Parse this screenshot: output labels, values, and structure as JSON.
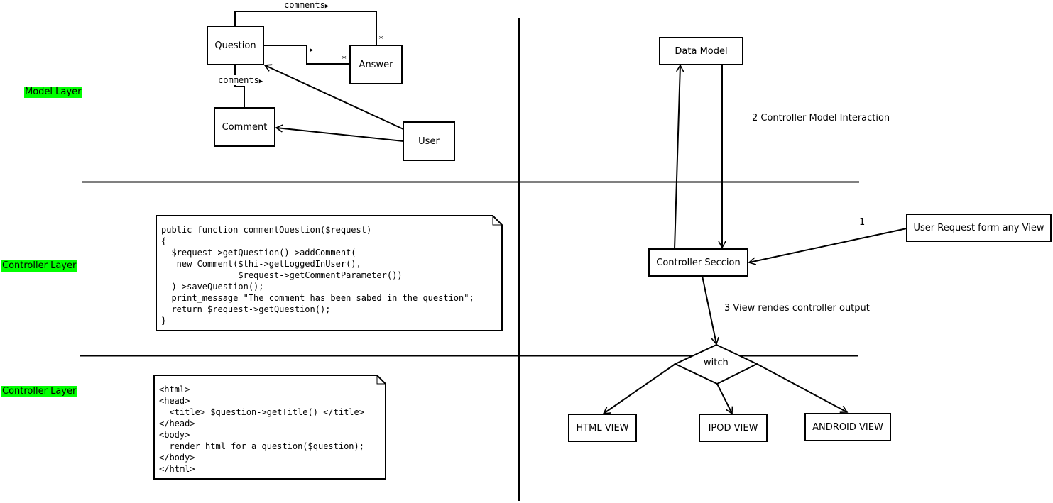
{
  "layers": {
    "model": {
      "label": "Model Layer",
      "highlight_color": "#00ff00"
    },
    "controller": {
      "label": "Controller Layer",
      "highlight_color": "#00ff00"
    },
    "view": {
      "label": "Controller Layer",
      "highlight_color": "#00ff00"
    }
  },
  "uml": {
    "classes": {
      "question": "Question",
      "answer": "Answer",
      "comment": "Comment",
      "user": "User"
    },
    "associations": {
      "question_answer_top": {
        "label": "comments",
        "direction_glyph": "▶",
        "multiplicity_answer": "*"
      },
      "question_answer_mid": {
        "direction_glyph": "▶",
        "multiplicity_answer": "*"
      },
      "question_comment": {
        "label": "comments",
        "direction_glyph": "▶"
      }
    }
  },
  "controller_code": {
    "lines": [
      "public function commentQuestion($request)",
      "{",
      "  $request->getQuestion()->addComment(",
      "   new Comment($thi->getLoggedInUser(),",
      "               $request->getCommentParameter())",
      "  )->saveQuestion();",
      "  print_message \"The comment has been sabed in the question\";",
      "  return $request->getQuestion();",
      "}"
    ]
  },
  "view_code": {
    "lines": [
      "<html>",
      "<head>",
      "  <title> $question->getTitle() </title>",
      "</head>",
      "<body>",
      "  render_html_for_a_question($question);",
      "</body>",
      "</html>"
    ]
  },
  "flow": {
    "data_model": "Data Model",
    "controller": "Controller Seccion",
    "user_request": "User Request form any View",
    "switch": "witch",
    "views": {
      "html": "HTML VIEW",
      "ipod": "IPOD VIEW",
      "android": "ANDROID VIEW"
    },
    "steps": {
      "step1": "1",
      "step2": "2 Controller Model Interaction",
      "step3": "3 View rendes controller output"
    }
  }
}
